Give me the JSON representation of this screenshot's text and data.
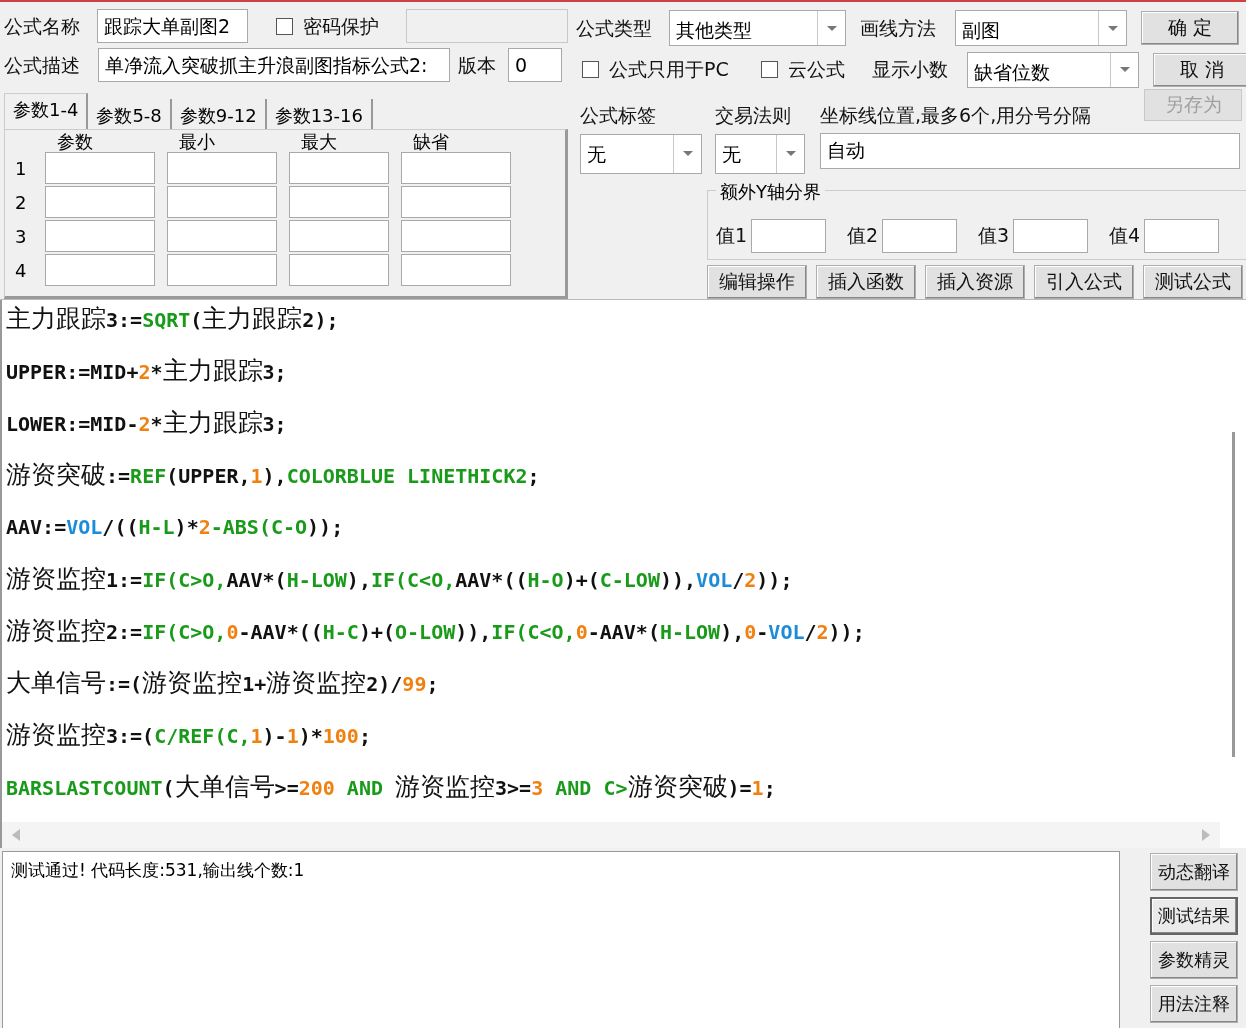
{
  "name": {
    "label": "公式名称",
    "value": "跟踪大单副图2"
  },
  "password": {
    "label": "密码保护",
    "checked": false
  },
  "description": {
    "label": "公式描述",
    "value": "单净流入突破抓主升浪副图指标公式2:"
  },
  "version": {
    "label": "版本",
    "value": "0"
  },
  "param_tabs": [
    {
      "label": "参数1-4",
      "selected": true
    },
    {
      "label": "参数5-8",
      "selected": false
    },
    {
      "label": "参数9-12",
      "selected": false
    },
    {
      "label": "参数13-16",
      "selected": false
    }
  ],
  "param_columns": [
    "参数",
    "最小",
    "最大",
    "缺省"
  ],
  "param_rows": [
    "1",
    "2",
    "3",
    "4"
  ],
  "formula_type": {
    "label": "公式类型",
    "value": "其他类型"
  },
  "draw_method": {
    "label": "画线方法",
    "value": "副图"
  },
  "pc_only": {
    "label": "公式只用于PC",
    "checked": false
  },
  "cloud": {
    "label": "云公式",
    "checked": false
  },
  "decimals": {
    "label": "显示小数",
    "value": "缺省位数"
  },
  "dialog_buttons": [
    {
      "label": "确 定",
      "disabled": false
    },
    {
      "label": "取 消",
      "disabled": false
    },
    {
      "label": "另存为",
      "disabled": true
    }
  ],
  "formula_tag": {
    "label": "公式标签",
    "value": "无"
  },
  "trade_rule": {
    "label": "交易法则",
    "value": "无"
  },
  "axis_lines": {
    "label": "坐标线位置,最多6个,用分号分隔",
    "value": "自动"
  },
  "y_bounds": {
    "title": "额外Y轴分界",
    "fields": [
      "值1",
      "值2",
      "值3",
      "值4"
    ]
  },
  "tool_buttons": [
    "编辑操作",
    "插入函数",
    "插入资源",
    "引入公式",
    "测试公式"
  ],
  "code_lines": [
    [
      {
        "t": "主力跟踪3:=",
        "kind": "text"
      },
      {
        "t": "SQRT",
        "kind": "func"
      },
      {
        "t": "(主力跟踪2);",
        "kind": "text"
      }
    ],
    [
      {
        "t": "UPPER:=MID+",
        "kind": "text"
      },
      {
        "t": "2",
        "kind": "num"
      },
      {
        "t": "*主力跟踪3;",
        "kind": "text"
      }
    ],
    [
      {
        "t": "LOWER:=MID-",
        "kind": "text"
      },
      {
        "t": "2",
        "kind": "num"
      },
      {
        "t": "*主力跟踪3;",
        "kind": "text"
      }
    ],
    [
      {
        "t": "游资突破:=",
        "kind": "text"
      },
      {
        "t": "REF",
        "kind": "func"
      },
      {
        "t": "(UPPER,",
        "kind": "text"
      },
      {
        "t": "1",
        "kind": "num"
      },
      {
        "t": "),",
        "kind": "text"
      },
      {
        "t": "COLORBLUE LINETHICK2",
        "kind": "func"
      },
      {
        "t": ";",
        "kind": "text"
      }
    ],
    [
      {
        "t": "AAV:=",
        "kind": "text"
      },
      {
        "t": "VOL",
        "kind": "var"
      },
      {
        "t": "/((",
        "kind": "text"
      },
      {
        "t": "H-L",
        "kind": "func"
      },
      {
        "t": ")*",
        "kind": "text"
      },
      {
        "t": "2",
        "kind": "num"
      },
      {
        "t": "-ABS(C-O",
        "kind": "func"
      },
      {
        "t": "));",
        "kind": "text"
      }
    ],
    [
      {
        "t": "游资监控1:=",
        "kind": "text"
      },
      {
        "t": "IF(C>O,",
        "kind": "func"
      },
      {
        "t": "AAV*(",
        "kind": "text"
      },
      {
        "t": "H-LOW",
        "kind": "func"
      },
      {
        "t": "),",
        "kind": "text"
      },
      {
        "t": "IF(C<O,",
        "kind": "func"
      },
      {
        "t": "AAV*((",
        "kind": "text"
      },
      {
        "t": "H-O",
        "kind": "func"
      },
      {
        "t": ")+(",
        "kind": "text"
      },
      {
        "t": "C-LOW",
        "kind": "func"
      },
      {
        "t": ")),",
        "kind": "text"
      },
      {
        "t": "VOL",
        "kind": "var"
      },
      {
        "t": "/",
        "kind": "text"
      },
      {
        "t": "2",
        "kind": "num"
      },
      {
        "t": "));",
        "kind": "text"
      }
    ],
    [
      {
        "t": "游资监控2:=",
        "kind": "text"
      },
      {
        "t": "IF(C>O,",
        "kind": "func"
      },
      {
        "t": "0",
        "kind": "num"
      },
      {
        "t": "-AAV*((",
        "kind": "text"
      },
      {
        "t": "H-C",
        "kind": "func"
      },
      {
        "t": ")+(",
        "kind": "text"
      },
      {
        "t": "O-LOW",
        "kind": "func"
      },
      {
        "t": ")),",
        "kind": "text"
      },
      {
        "t": "IF(C<O,",
        "kind": "func"
      },
      {
        "t": "0",
        "kind": "num"
      },
      {
        "t": "-AAV*(",
        "kind": "text"
      },
      {
        "t": "H-LOW",
        "kind": "func"
      },
      {
        "t": "),",
        "kind": "text"
      },
      {
        "t": "0",
        "kind": "num"
      },
      {
        "t": "-",
        "kind": "text"
      },
      {
        "t": "VOL",
        "kind": "var"
      },
      {
        "t": "/",
        "kind": "text"
      },
      {
        "t": "2",
        "kind": "num"
      },
      {
        "t": "));",
        "kind": "text"
      }
    ],
    [
      {
        "t": "大单信号:=(游资监控1+游资监控2)/",
        "kind": "text"
      },
      {
        "t": "99",
        "kind": "num"
      },
      {
        "t": ";",
        "kind": "text"
      }
    ],
    [
      {
        "t": "游资监控3:=(",
        "kind": "text"
      },
      {
        "t": "C/REF(C,",
        "kind": "func"
      },
      {
        "t": "1",
        "kind": "num"
      },
      {
        "t": ")-",
        "kind": "text"
      },
      {
        "t": "1",
        "kind": "num"
      },
      {
        "t": ")*",
        "kind": "text"
      },
      {
        "t": "100",
        "kind": "num"
      },
      {
        "t": ";",
        "kind": "text"
      }
    ],
    [
      {
        "t": "BARSLASTCOUNT",
        "kind": "func"
      },
      {
        "t": "(大单信号>=",
        "kind": "text"
      },
      {
        "t": "200",
        "kind": "num"
      },
      {
        "t": " AND ",
        "kind": "func"
      },
      {
        "t": "游资监控3>=",
        "kind": "text"
      },
      {
        "t": "3",
        "kind": "num"
      },
      {
        "t": " AND ",
        "kind": "func"
      },
      {
        "t": "C>",
        "kind": "func"
      },
      {
        "t": "游资突破)=",
        "kind": "text"
      },
      {
        "t": "1",
        "kind": "num"
      },
      {
        "t": ";",
        "kind": "text"
      }
    ]
  ],
  "output": "测试通过! 代码长度:531,输出线个数:1",
  "side_buttons": [
    {
      "label": "动态翻译",
      "selected": false
    },
    {
      "label": "测试结果",
      "selected": true
    },
    {
      "label": "参数精灵",
      "selected": false
    },
    {
      "label": "用法注释",
      "selected": false
    }
  ]
}
